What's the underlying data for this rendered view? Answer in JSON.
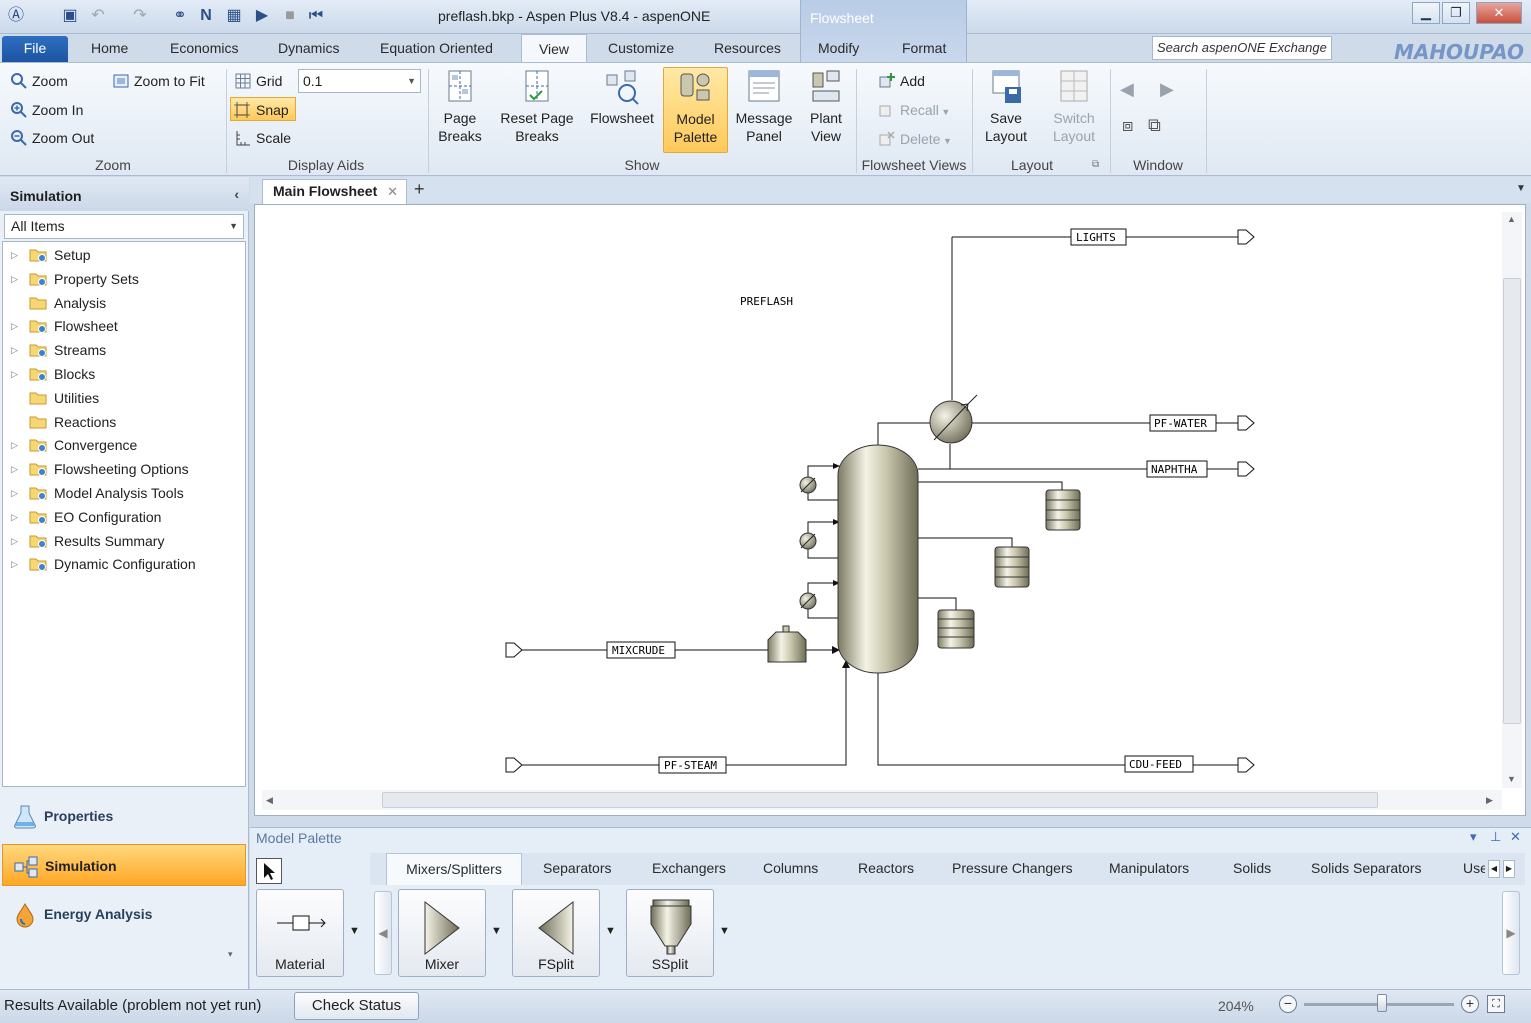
{
  "window": {
    "title": "preflash.bkp - Aspen Plus V8.4 - aspenONE",
    "context_tab_group": "Flowsheet",
    "search_placeholder": "Search aspenONE Exchange",
    "watermark": "MAHOUPAO"
  },
  "menu_tabs": [
    "File",
    "Home",
    "Economics",
    "Dynamics",
    "Equation Oriented",
    "View",
    "Customize",
    "Resources",
    "Modify",
    "Format"
  ],
  "active_menu_tab": "View",
  "ribbon": {
    "zoom": {
      "label": "Zoom",
      "items": [
        "Zoom",
        "Zoom In",
        "Zoom Out",
        "Zoom to Fit"
      ]
    },
    "display_aids": {
      "label": "Display Aids",
      "grid": "Grid",
      "grid_value": "0.1",
      "snap": "Snap",
      "scale": "Scale"
    },
    "show": {
      "label": "Show",
      "page_breaks": "Page Breaks",
      "reset_page_breaks": "Reset Page Breaks",
      "flowsheet": "Flowsheet",
      "model_palette": "Model Palette",
      "message_panel": "Message Panel",
      "plant_view": "Plant View"
    },
    "flowsheet_views": {
      "label": "Flowsheet Views",
      "add": "Add",
      "recall": "Recall",
      "delete": "Delete"
    },
    "layout": {
      "label": "Layout",
      "save_layout": "Save Layout",
      "switch_layout": "Switch Layout"
    },
    "window": {
      "label": "Window"
    }
  },
  "nav": {
    "header": "Simulation",
    "filter": "All Items",
    "tree": [
      {
        "label": "Setup",
        "expandable": true
      },
      {
        "label": "Property Sets",
        "expandable": true
      },
      {
        "label": "Analysis",
        "expandable": false
      },
      {
        "label": "Flowsheet",
        "expandable": true
      },
      {
        "label": "Streams",
        "expandable": true
      },
      {
        "label": "Blocks",
        "expandable": true
      },
      {
        "label": "Utilities",
        "expandable": false
      },
      {
        "label": "Reactions",
        "expandable": false
      },
      {
        "label": "Convergence",
        "expandable": true
      },
      {
        "label": "Flowsheeting Options",
        "expandable": true
      },
      {
        "label": "Model Analysis Tools",
        "expandable": true
      },
      {
        "label": "EO Configuration",
        "expandable": true
      },
      {
        "label": "Results Summary",
        "expandable": true
      },
      {
        "label": "Dynamic Configuration",
        "expandable": true
      }
    ],
    "buttons": [
      "Properties",
      "Simulation",
      "Energy Analysis"
    ],
    "active_button": "Simulation"
  },
  "document": {
    "tab": "Main Flowsheet",
    "flowsheet_title": "PREFLASH",
    "streams": [
      "LIGHTS",
      "PF-WATER",
      "NAPHTHA",
      "MIXCRUDE",
      "PF-STEAM",
      "CDU-FEED"
    ]
  },
  "palette": {
    "title": "Model Palette",
    "tabs": [
      "Mixers/Splitters",
      "Separators",
      "Exchangers",
      "Columns",
      "Reactors",
      "Pressure Changers",
      "Manipulators",
      "Solids",
      "Solids Separators",
      "Use"
    ],
    "active_tab": "Mixers/Splitters",
    "items": [
      "Material",
      "Mixer",
      "FSplit",
      "SSplit"
    ]
  },
  "status": {
    "message": "Results Available (problem not yet run)",
    "check_status": "Check Status",
    "zoom_level": "204%"
  },
  "colors": {
    "accent_blue": "#1b55a3",
    "active_orange": "#ffa726",
    "equipment_fill": "#c9c7ad"
  }
}
